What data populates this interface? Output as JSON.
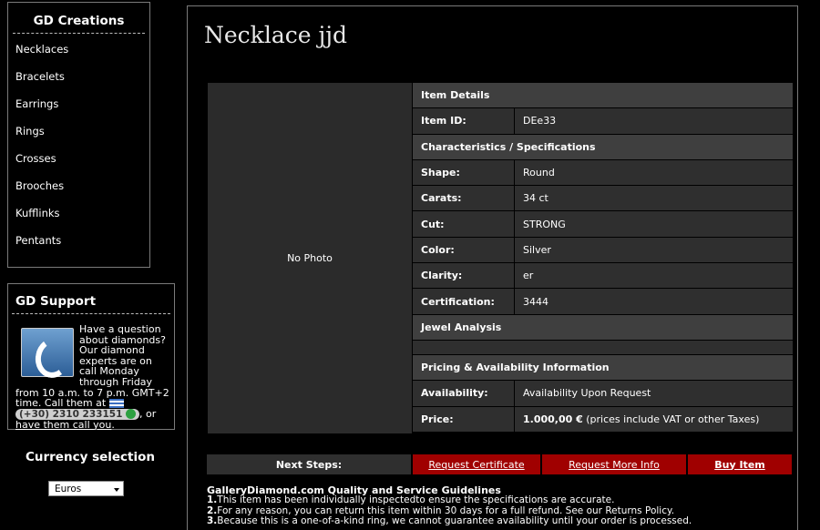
{
  "creations": {
    "title": "GD Creations",
    "items": [
      "Necklaces",
      "Bracelets",
      "Earrings",
      "Rings",
      "Crosses",
      "Brooches",
      "Kufflinks",
      "Pentants"
    ]
  },
  "support": {
    "title": "GD Support",
    "text": "Have a question about diamonds? Our diamond experts are on call Monday through Friday from 10 a.m. to 7 p.m. GMT+2 time. Call them at",
    "phone": "(+30) 2310 233151",
    "or": ", or",
    "call_link": "have them call you",
    "end": "."
  },
  "currency": {
    "title": "Currency selection",
    "selected": "Euros"
  },
  "product": {
    "title": "Necklace jjd",
    "no_photo": "No Photo"
  },
  "details": {
    "item_details": "Item Details",
    "item_id_label": "Item ID:",
    "item_id": "DEe33",
    "characteristics": "Characteristics / Specifications",
    "shape_label": "Shape:",
    "shape": "Round",
    "carats_label": "Carats:",
    "carats": "34 ct",
    "cut_label": "Cut:",
    "cut": "STRONG",
    "color_label": "Color:",
    "color": "Silver",
    "clarity_label": "Clarity:",
    "clarity": "er",
    "cert_label": "Certification:",
    "cert": "3444",
    "jewel_analysis": "Jewel Analysis",
    "pricing": "Pricing & Availability Information",
    "availability_label": "Availability:",
    "availability": "Availability Upon Request",
    "price_label": "Price:",
    "price": "1.000,00 €",
    "price_note": " (prices include VAT or other Taxes)"
  },
  "steps": {
    "label": "Next Steps:",
    "request_certificate": "Request Certificate",
    "request_info": "Request More Info",
    "buy": "Buy Item"
  },
  "guidelines": {
    "title": "GalleryDiamond.com Quality and Service Guidelines",
    "line1_num": "1.",
    "line1": "This item has been individually inspectedto ensure the specifications are accurate.",
    "line2_num": "2.",
    "line2": "For any reason, you can return this item within 30 days for a full refund. See our Returns Policy.",
    "line3_num": "3.",
    "line3": "Because this is a one-of-a-kind ring, we cannot guarantee availability until your order is processed."
  }
}
